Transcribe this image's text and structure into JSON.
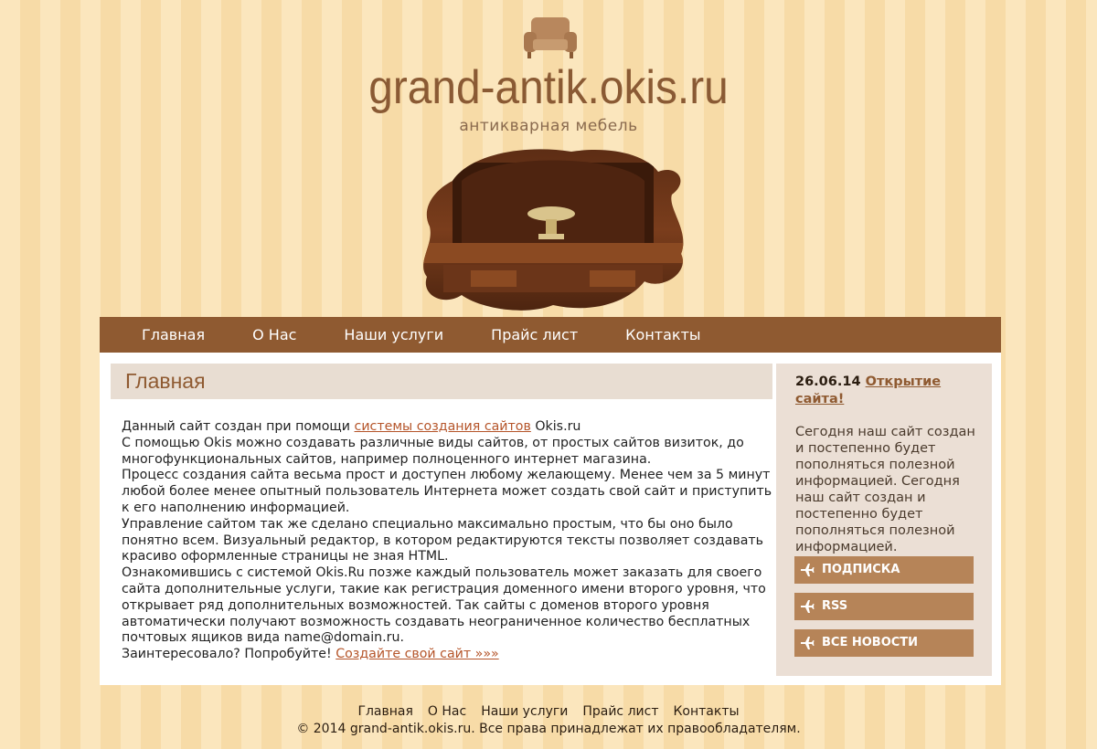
{
  "header": {
    "site_title": "grand-antik.okis.ru",
    "subtitle": "антикварная мебель",
    "logo_icon": "sofa-icon",
    "hero_image": "antique-cabinet-photo"
  },
  "nav": {
    "items": [
      {
        "label": "Главная"
      },
      {
        "label": "О Нас"
      },
      {
        "label": "Наши услуги"
      },
      {
        "label": "Прайс лист"
      },
      {
        "label": "Контакты"
      }
    ]
  },
  "main": {
    "title": "Главная",
    "p1_before": "Данный сайт создан при помощи ",
    "p1_link": "системы создания сайтов",
    "p1_after": " Okis.ru",
    "p2": "С помощью Okis можно создавать различные виды сайтов, от простых сайтов визиток, до многофункциональных сайтов, например полноценного интернет магазина.",
    "p3": "Процесс создания сайта весьма прост и доступен любому желающему. Менее чем за 5 минут любой более менее опытный пользователь Интернета может создать свой сайт и приступить к его наполнению информацией.",
    "p4": "Управление сайтом так же сделано специально максимально простым, что бы оно было понятно всем. Визуальный редактор, в котором редактируются тексты позволяет создавать красиво оформленные страницы не зная HTML.",
    "p5": "Ознакомившись с системой Okis.Ru позже каждый пользователь может заказать для своего сайта дополнительные услуги, такие как регистрация доменного имени второго уровня, что открывает ряд дополнительных возможностей. Так сайты с доменов второго уровня автоматически получают возможность создавать неограниченное количество бесплатных почтовых ящиков вида name@domain.ru.",
    "p6_before": "Заинтересовало? Попробуйте! ",
    "p6_link": "Создайте свой сайт »»»"
  },
  "sidebar": {
    "news_date": "26.06.14",
    "news_link": "Открытие сайта!",
    "news_text": "Сегодня наш сайт создан и постепенно будет пополняться полезной информацией. Сегодня наш сайт создан и постепенно будет пополняться полезной информацией.",
    "buttons": [
      {
        "label": "ПОДПИСКА",
        "icon": "airplane-icon"
      },
      {
        "label": "RSS",
        "icon": "airplane-icon"
      },
      {
        "label": "ВСЕ НОВОСТИ",
        "icon": "airplane-icon"
      }
    ]
  },
  "footer": {
    "nav": [
      {
        "label": "Главная"
      },
      {
        "label": "О Нас"
      },
      {
        "label": "Наши услуги"
      },
      {
        "label": "Прайс лист"
      },
      {
        "label": "Контакты"
      }
    ],
    "copyright": "© 2014 grand-antik.okis.ru. Все права принадлежат их правообладателям."
  },
  "colors": {
    "nav_bg": "#8f5a31",
    "accent": "#b68458",
    "link": "#b5552a",
    "title": "#8a5a34"
  }
}
